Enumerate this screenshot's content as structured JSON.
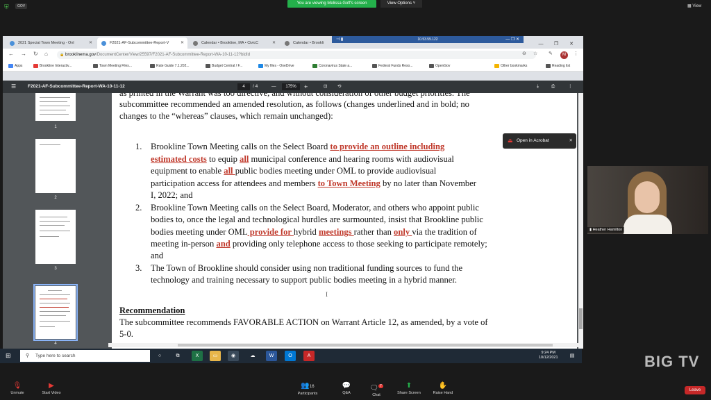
{
  "zoom": {
    "badge": "GOV",
    "share_banner": "You are viewing Melissa Goff's screen",
    "view_options": "View Options ˅",
    "view": "View",
    "participants_count": "16",
    "chat_count": "7",
    "toolbar": [
      {
        "label": "Unmute",
        "icon": "mic-muted-icon"
      },
      {
        "label": "Start Video",
        "icon": "video-off-icon"
      },
      {
        "label": "Participants",
        "icon": "participants-icon"
      },
      {
        "label": "Q&A",
        "icon": "qa-icon"
      },
      {
        "label": "Chat",
        "icon": "chat-icon"
      },
      {
        "label": "Share Screen",
        "icon": "share-screen-icon"
      },
      {
        "label": "Raise Hand",
        "icon": "raise-hand-icon"
      }
    ],
    "leave": "Leave",
    "webcam_name": "Heather Hamilton",
    "remote_ip": "10.53.55.122"
  },
  "browser": {
    "tabs": [
      {
        "title": "2021 Special Town Meeting - Onl",
        "favicon_color": "#4a90d9"
      },
      {
        "title": "F2021-AF-Subcommittee-Report-V",
        "favicon_color": "#4a90d9"
      },
      {
        "title": "Calendar • Brookline, MA • CivicC",
        "favicon_color": "#777777"
      },
      {
        "title": "Calendar • Brookli",
        "favicon_color": "#777777"
      }
    ],
    "url_host": "brooklinema.gov",
    "url_path": "/DocumentCenter/View/25597/F2021-AF-Subcommittee-Report-WA-10-11-12?bidId",
    "avatar_letter": "M",
    "bookmarks": [
      {
        "label": "Apps",
        "color": "#4285f4"
      },
      {
        "label": "Brookline Interactiv...",
        "color": "#e53935"
      },
      {
        "label": "Town Meeting Files...",
        "color": "#555555"
      },
      {
        "label": "Rate Guide 7.1.202...",
        "color": "#555555"
      },
      {
        "label": "Budget Central / F...",
        "color": "#555555"
      },
      {
        "label": "My files - OneDrive",
        "color": "#1e88e5"
      },
      {
        "label": "Coronavirus State a...",
        "color": "#2e7d32"
      },
      {
        "label": "Federal Funds Reso...",
        "color": "#555555"
      },
      {
        "label": "OpenGov",
        "color": "#555555"
      },
      {
        "label": "Other bookmarks",
        "color": "#f4b400"
      },
      {
        "label": "Reading list",
        "color": "#555555"
      }
    ]
  },
  "pdf": {
    "title": "F2021-AF-Subcommittee-Report-WA-10-11-12",
    "page_current": "4",
    "page_total": "/ 4",
    "zoom": "175%",
    "thumb_numbers": [
      "1",
      "2",
      "3",
      "4"
    ],
    "open_in_acrobat": "Open in Acrobat",
    "intro": [
      "as printed in the Warrant was too directive, and without consideration of other budget priorities. The",
      "subcommittee recommended an amended  resolution, as follows (changes underlined and in bold; no",
      "changes to the “whereas” clauses, which remain unchanged):"
    ],
    "items": [
      {
        "num": "1.",
        "l1a": "Brookline Town Meeting calls on the Select Board ",
        "l1b": "to provide an outline",
        "l1c": " ",
        "l1d": "including",
        "l2a": "estimated costs",
        "l2b": " to equip ",
        "l2c": "all",
        "l2d": " municipal conference and hearing rooms with audiovisual",
        "l3a": "equipment to enable ",
        "l3b": "all ",
        "l3c": "public bodies meeting under OML to provide audiovisual",
        "l4a": "participation access for attendees and members ",
        "l4b": "to Town Meeting",
        "l4c": " by no later than November",
        "l5": "I, 2022; and"
      },
      {
        "num": "2.",
        "l1": "Brookline Town Meeting calls on the Select Board, Moderator, and others  who appoint public",
        "l2": "bodies to, once the legal and technological hurdles are  surmounted, insist that Brookline public",
        "l3a": "bodies meeting under OML",
        "l3b": " provide for ",
        "l3c": "hybrid ",
        "l3d": "meetings ",
        "l3e": "rather than ",
        "l3f": "only ",
        "l3g": "via the tradition of",
        "l4a": "meeting in-person ",
        "l4b": "and",
        "l4c": "  providing only telephone access to those  seeking to participate remotely;",
        "l5": "and"
      },
      {
        "num": "3.",
        "l1": "The Town of Brookline should consider using non  traditional funding sources to fund the",
        "l2": "technology and training necessary to support public bodies meeting in a hybrid manner."
      }
    ],
    "rec_heading": "Recommendation",
    "rec_l1": "The subcommittee recommends FAVORABLE ACTION on Warrant Article 12, as amended, by a vote of",
    "rec_l2": "5-0."
  },
  "taskbar": {
    "search_placeholder": "Type here to search",
    "time": "9:24 PM",
    "date": "10/12/2021"
  },
  "watermark": "BIG TV"
}
